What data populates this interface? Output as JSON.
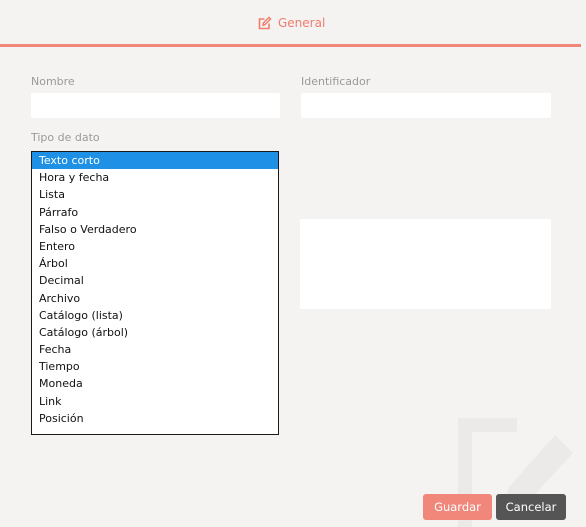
{
  "header": {
    "tab_label": "General"
  },
  "form": {
    "name_label": "Nombre",
    "identifier_label": "Identificador",
    "datatype_label": "Tipo de dato",
    "datatype_selected": "Texto corto",
    "datatype_options": [
      "Texto corto",
      "Hora y fecha",
      "Lista",
      "Párrafo",
      "Falso o Verdadero",
      "Entero",
      "Árbol",
      "Decimal",
      "Archivo",
      "Catálogo (lista)",
      "Catálogo (árbol)",
      "Fecha",
      "Tiempo",
      "Moneda",
      "Link",
      "Posición"
    ]
  },
  "footer": {
    "save_label": "Guardar",
    "cancel_label": "Cancelar"
  },
  "colors": {
    "accent": "#f0877a",
    "selected": "#1e90e6",
    "cancel": "#555555"
  },
  "icons": {
    "tab_icon": "edit-icon",
    "watermark": "edit-icon"
  }
}
